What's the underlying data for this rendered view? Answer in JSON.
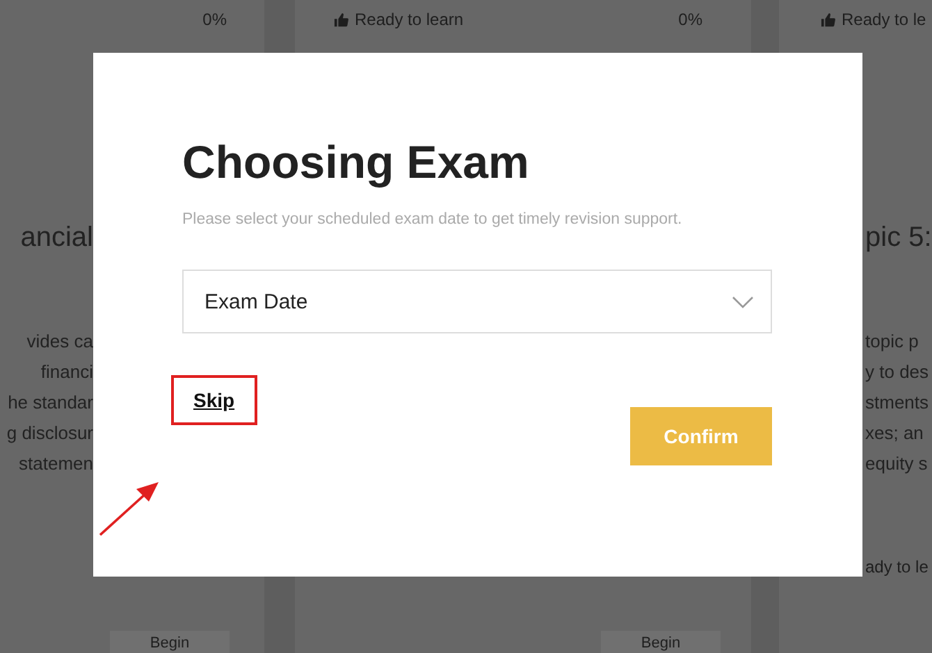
{
  "background": {
    "top_row": [
      {
        "progress": "0%",
        "status": "Ready to learn"
      },
      {
        "progress": "0%",
        "status": "Ready to le"
      }
    ],
    "left_card": {
      "title": "ancial",
      "lines": [
        "vides ca",
        "financi",
        "he standar",
        "g disclosur",
        "statemen"
      ]
    },
    "right_card": {
      "title": "pic 5:",
      "lines": [
        "topic p",
        "y to des",
        "stments",
        "xes; an",
        "equity s"
      ],
      "status": "ady to le"
    },
    "begin_buttons": [
      "Begin",
      "Begin"
    ]
  },
  "modal": {
    "title": "Choosing Exam",
    "subtitle": "Please select your scheduled exam date to get timely revision support.",
    "select": {
      "value": "Exam Date"
    },
    "skip": {
      "label": "Skip",
      "highlighted": true
    },
    "confirm": "Confirm"
  }
}
